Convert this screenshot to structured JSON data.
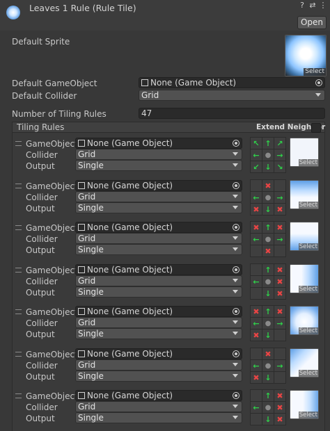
{
  "header": {
    "title": "Leaves 1 Rule (Rule Tile)",
    "help_icon": "help-icon",
    "settings_icon": "sliders-icon",
    "menu_icon": "kebab-menu-icon",
    "open_label": "Open"
  },
  "default_sprite": {
    "label": "Default Sprite",
    "select_label": "Select"
  },
  "default_gameobject": {
    "label": "Default GameObject",
    "value": "None (Game Object)"
  },
  "default_collider": {
    "label": "Default Collider",
    "value": "Grid"
  },
  "tiling_count": {
    "label": "Number of Tiling Rules",
    "value": "47"
  },
  "tiling_rules": {
    "title": "Tiling Rules",
    "extend_neighbor": "Extend Neighbor"
  },
  "rule_labels": {
    "gameobject": "GameObject",
    "collider": "Collider",
    "output": "Output",
    "select": "Select"
  },
  "rules": [
    {
      "gameobject": "None (Game Object)",
      "collider": "Grid",
      "output": "Single",
      "neighbors": [
        "up-left",
        "up",
        "up-right",
        "left",
        "this",
        "right",
        "down-left",
        "down",
        "down-right"
      ],
      "marks": [
        "t",
        "t",
        "t",
        "t",
        "c",
        "t",
        "t",
        "t",
        "t"
      ],
      "preview": "full"
    },
    {
      "gameobject": "None (Game Object)",
      "collider": "Grid",
      "output": "Single",
      "marks": [
        "",
        "n",
        "",
        "t",
        "c",
        "t",
        "n",
        "t",
        "n"
      ],
      "preview": "top-edge"
    },
    {
      "gameobject": "None (Game Object)",
      "collider": "Grid",
      "output": "Single",
      "marks": [
        "n",
        "t",
        "n",
        "t",
        "c",
        "t",
        "",
        "n",
        ""
      ],
      "preview": "bottom-edge"
    },
    {
      "gameobject": "None (Game Object)",
      "collider": "Grid",
      "output": "Single",
      "marks": [
        "",
        "t",
        "n",
        "t",
        "c",
        "n",
        "",
        "t",
        "n"
      ],
      "preview": "right-edge"
    },
    {
      "gameobject": "None (Game Object)",
      "collider": "Grid",
      "output": "Single",
      "marks": [
        "n",
        "t",
        "n",
        "t",
        "c",
        "t",
        "n",
        "t",
        ""
      ],
      "preview": "corner"
    },
    {
      "gameobject": "None (Game Object)",
      "collider": "Grid",
      "output": "Single",
      "marks": [
        "",
        "n",
        "",
        "t",
        "c",
        "t",
        "n",
        "t",
        ""
      ],
      "preview": "top-left"
    },
    {
      "gameobject": "None (Game Object)",
      "collider": "Grid",
      "output": "Single",
      "marks": [
        "",
        "t",
        "n",
        "t",
        "c",
        "n",
        "",
        "t",
        "n"
      ],
      "preview": "right-side"
    }
  ],
  "colors": {
    "background": "#383838",
    "field": "#2a2a2a",
    "dropdown": "#515151",
    "this_match": "#2fd14a",
    "not_match": "#e84545"
  }
}
